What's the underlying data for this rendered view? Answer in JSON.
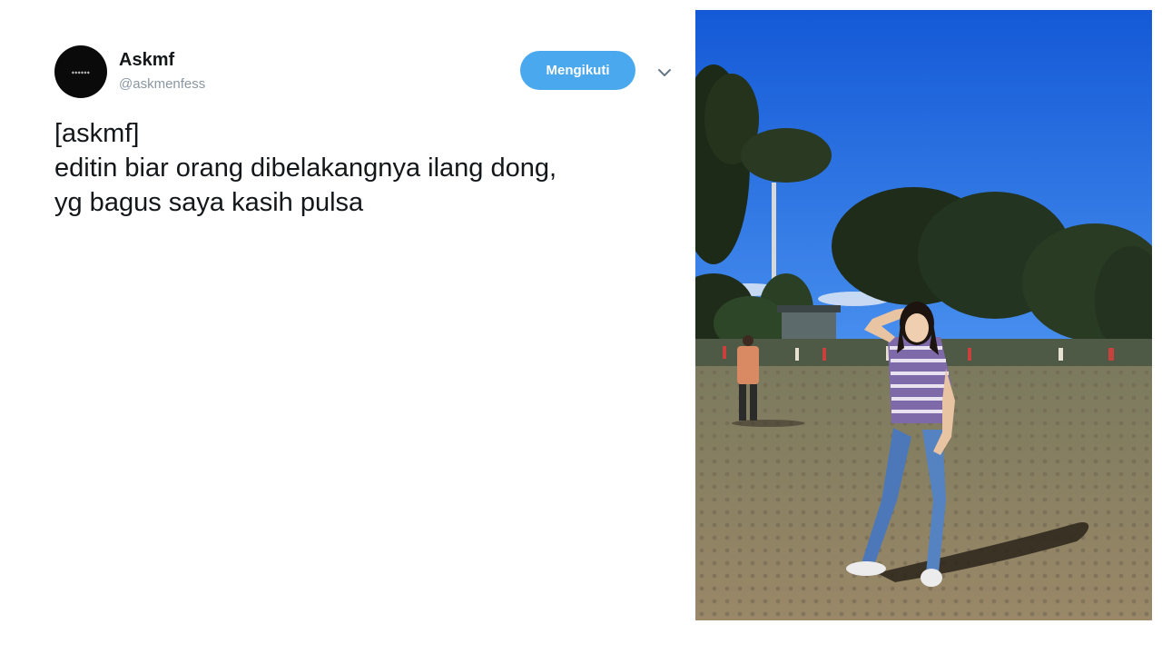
{
  "tweet": {
    "display_name": "Askmf",
    "handle": "@askmenfess",
    "avatar_icon": "askmenfess-logo-avatar",
    "follow_label": "Mengikuti",
    "more_icon": "chevron-down-icon",
    "text_lines": [
      "[askmf]",
      "editin biar orang dibelakangnya ilang dong,",
      "yg bagus saya kasih pulsa"
    ]
  },
  "media": {
    "description_icon": "tweet-photo",
    "sky_color": "#1e6fe6",
    "ground_color": "#8f8060"
  },
  "colors": {
    "accent": "#4aa8ee",
    "text": "#14171a",
    "muted": "#8a97a3"
  }
}
